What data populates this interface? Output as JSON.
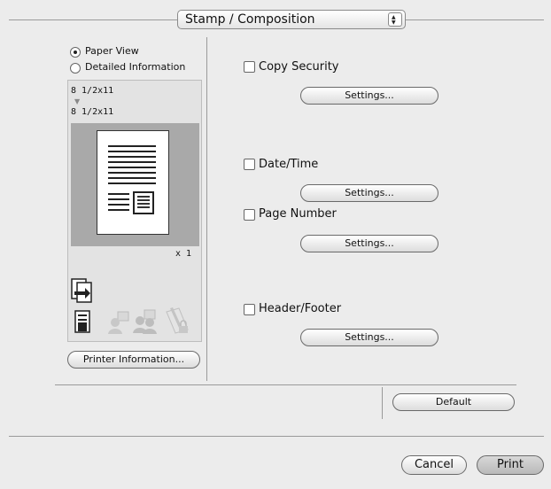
{
  "popup": {
    "label": "Stamp / Composition"
  },
  "view_options": {
    "paper_view": "Paper View",
    "detailed_information": "Detailed Information",
    "selected": "paper_view"
  },
  "preview": {
    "source_size": "8 1/2x11",
    "output_size": "8 1/2x11",
    "copies": "x 1"
  },
  "printer_info_button": "Printer Information...",
  "options": [
    {
      "label": "Copy Security",
      "checked": false,
      "button": "Settings..."
    },
    {
      "label": "Date/Time",
      "checked": false,
      "button": "Settings..."
    },
    {
      "label": "Page Number",
      "checked": false,
      "button": "Settings..."
    },
    {
      "label": "Header/Footer",
      "checked": false,
      "button": "Settings..."
    }
  ],
  "default_button": "Default",
  "footer": {
    "cancel": "Cancel",
    "print": "Print"
  },
  "icons": [
    "duplex-icon",
    "document-icon",
    "user-icon",
    "users-icon",
    "locked-pen-icon",
    "arrow-down-icon"
  ]
}
